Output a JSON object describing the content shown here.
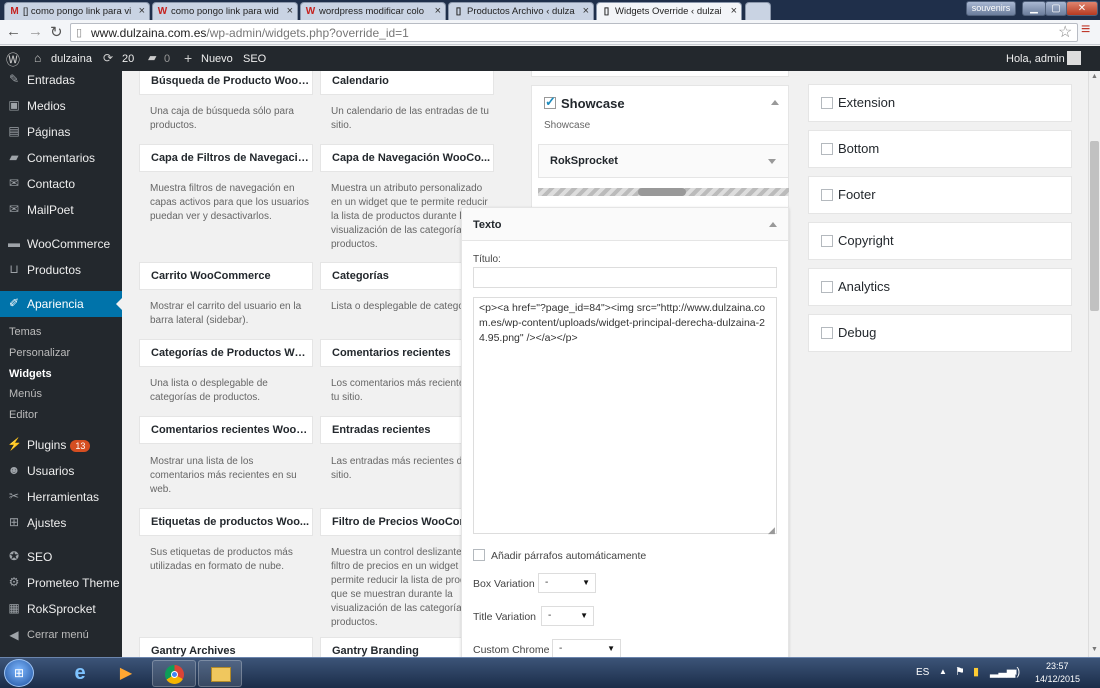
{
  "browser": {
    "tabs": [
      {
        "label": "[] como pongo link para vi",
        "icon": "gmail-icon",
        "glyph": "M"
      },
      {
        "label": "como pongo link para wid",
        "icon": "wordpress-org-icon",
        "glyph": "W"
      },
      {
        "label": "wordpress modificar colo",
        "icon": "wordpress-org-icon",
        "glyph": "W"
      },
      {
        "label": "Productos Archivo ‹ dulza",
        "icon": "page-icon",
        "glyph": "▯"
      },
      {
        "label": "Widgets Override ‹ dulzai",
        "icon": "page-icon",
        "glyph": "▯"
      }
    ],
    "profile_label": "souvenirs",
    "url_host": "www.dulzaina.com.es",
    "url_path": "/wp-admin/widgets.php?override_id=1"
  },
  "adminbar": {
    "site": "dulzaina",
    "updates": "20",
    "comments": "0",
    "new": "Nuevo",
    "seo": "SEO",
    "greeting": "Hola, admin"
  },
  "sidebar": {
    "items": [
      {
        "label": "Entradas",
        "icon": "pin-icon"
      },
      {
        "label": "Medios",
        "icon": "media-icon"
      },
      {
        "label": "Páginas",
        "icon": "pages-icon"
      },
      {
        "label": "Comentarios",
        "icon": "comment-icon"
      },
      {
        "label": "Contacto",
        "icon": "mail-icon"
      },
      {
        "label": "MailPoet",
        "icon": "mail-icon"
      },
      {
        "label": "WooCommerce",
        "icon": "woo-icon"
      },
      {
        "label": "Productos",
        "icon": "cart-icon"
      },
      {
        "label": "Apariencia",
        "icon": "brush-icon"
      },
      {
        "label": "Plugins",
        "icon": "plugin-icon",
        "badge": "13"
      },
      {
        "label": "Usuarios",
        "icon": "user-icon"
      },
      {
        "label": "Herramientas",
        "icon": "wrench-icon"
      },
      {
        "label": "Ajustes",
        "icon": "settings-icon"
      },
      {
        "label": "SEO",
        "icon": "seo-icon"
      },
      {
        "label": "Prometeo Theme",
        "icon": "gear-icon"
      },
      {
        "label": "RokSprocket",
        "icon": "rocket-icon"
      }
    ],
    "submenu": [
      "Temas",
      "Personalizar",
      "Widgets",
      "Menús",
      "Editor"
    ],
    "collapse": "Cerrar menú"
  },
  "available_widgets": [
    {
      "title": "Búsqueda de Producto WooC...",
      "desc": "Una caja de búsqueda sólo para productos."
    },
    {
      "title": "Calendario",
      "desc": "Un calendario de las entradas de tu sitio."
    },
    {
      "title": "Capa de Filtros de Navegació...",
      "desc": "Muestra filtros de navegación en capas activos para que los usuarios puedan ver y desactivarlos."
    },
    {
      "title": "Capa de Navegación WooCo...",
      "desc": "Muestra un atributo personalizado en un widget que te permite reducir la lista de productos durante la visualización de las categorías de productos."
    },
    {
      "title": "Carrito WooCommerce",
      "desc": "Mostrar el carrito del usuario en la barra lateral (sidebar)."
    },
    {
      "title": "Categorías",
      "desc": "Lista o desplegable de categorías."
    },
    {
      "title": "Categorías de Productos Woo...",
      "desc": "Una lista o desplegable de categorías de productos."
    },
    {
      "title": "Comentarios recientes",
      "desc": "Los comentarios más recientes de tu sitio."
    },
    {
      "title": "Comentarios recientes WooC...",
      "desc": "Mostrar una lista de los comentarios más recientes en su web."
    },
    {
      "title": "Entradas recientes",
      "desc": "Las entradas más recientes de tu sitio."
    },
    {
      "title": "Etiquetas de productos Woo...",
      "desc": "Sus etiquetas de productos más utilizadas en formato de nube."
    },
    {
      "title": "Filtro de Precios WooCommerce",
      "desc": "Muestra un control deslizante de filtro de precios en un widget que te permite reducir la lista de productos que se muestran durante la visualización de las categorías de productos."
    },
    {
      "title": "Gantry Archives",
      "desc": ""
    },
    {
      "title": "Gantry Branding",
      "desc": ""
    }
  ],
  "showcase": {
    "title": "Showcase",
    "subtitle": "Showcase",
    "roksprocket": "RokSprocket"
  },
  "text_widget": {
    "header": "Texto",
    "title_label": "Título:",
    "title_value": "",
    "content": "<p><a href=\"?page_id=84\"><img src=\"http://www.dulzaina.com.es/wp-content/uploads/widget-principal-derecha-dulzaina-24.95.png\" /></a></p>",
    "autop_label": "Añadir párrafos automáticamente",
    "box_variation_label": "Box Variation",
    "title_variation_label": "Title Variation",
    "custom_chrome_label": "Custom Chrome",
    "select_value": "-"
  },
  "positions": [
    "Extension",
    "Bottom",
    "Footer",
    "Copyright",
    "Analytics",
    "Debug"
  ],
  "taskbar": {
    "lang": "ES",
    "time": "23:57",
    "date": "14/12/2015"
  }
}
